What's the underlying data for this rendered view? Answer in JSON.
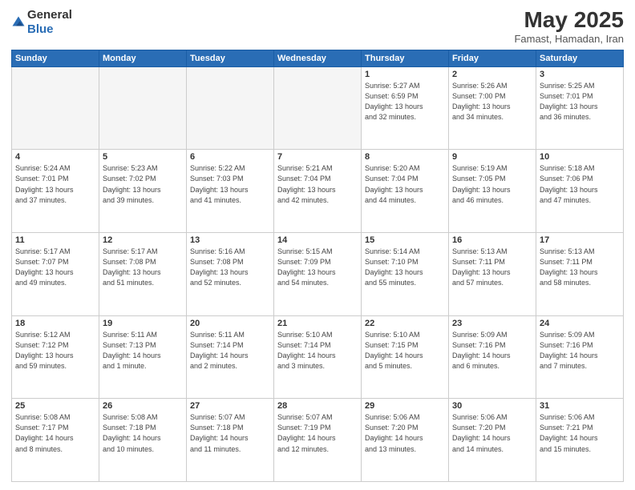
{
  "header": {
    "logo_general": "General",
    "logo_blue": "Blue",
    "month_year": "May 2025",
    "location": "Famast, Hamadan, Iran"
  },
  "weekdays": [
    "Sunday",
    "Monday",
    "Tuesday",
    "Wednesday",
    "Thursday",
    "Friday",
    "Saturday"
  ],
  "weeks": [
    [
      {
        "day": "",
        "info": ""
      },
      {
        "day": "",
        "info": ""
      },
      {
        "day": "",
        "info": ""
      },
      {
        "day": "",
        "info": ""
      },
      {
        "day": "1",
        "info": "Sunrise: 5:27 AM\nSunset: 6:59 PM\nDaylight: 13 hours\nand 32 minutes."
      },
      {
        "day": "2",
        "info": "Sunrise: 5:26 AM\nSunset: 7:00 PM\nDaylight: 13 hours\nand 34 minutes."
      },
      {
        "day": "3",
        "info": "Sunrise: 5:25 AM\nSunset: 7:01 PM\nDaylight: 13 hours\nand 36 minutes."
      }
    ],
    [
      {
        "day": "4",
        "info": "Sunrise: 5:24 AM\nSunset: 7:01 PM\nDaylight: 13 hours\nand 37 minutes."
      },
      {
        "day": "5",
        "info": "Sunrise: 5:23 AM\nSunset: 7:02 PM\nDaylight: 13 hours\nand 39 minutes."
      },
      {
        "day": "6",
        "info": "Sunrise: 5:22 AM\nSunset: 7:03 PM\nDaylight: 13 hours\nand 41 minutes."
      },
      {
        "day": "7",
        "info": "Sunrise: 5:21 AM\nSunset: 7:04 PM\nDaylight: 13 hours\nand 42 minutes."
      },
      {
        "day": "8",
        "info": "Sunrise: 5:20 AM\nSunset: 7:04 PM\nDaylight: 13 hours\nand 44 minutes."
      },
      {
        "day": "9",
        "info": "Sunrise: 5:19 AM\nSunset: 7:05 PM\nDaylight: 13 hours\nand 46 minutes."
      },
      {
        "day": "10",
        "info": "Sunrise: 5:18 AM\nSunset: 7:06 PM\nDaylight: 13 hours\nand 47 minutes."
      }
    ],
    [
      {
        "day": "11",
        "info": "Sunrise: 5:17 AM\nSunset: 7:07 PM\nDaylight: 13 hours\nand 49 minutes."
      },
      {
        "day": "12",
        "info": "Sunrise: 5:17 AM\nSunset: 7:08 PM\nDaylight: 13 hours\nand 51 minutes."
      },
      {
        "day": "13",
        "info": "Sunrise: 5:16 AM\nSunset: 7:08 PM\nDaylight: 13 hours\nand 52 minutes."
      },
      {
        "day": "14",
        "info": "Sunrise: 5:15 AM\nSunset: 7:09 PM\nDaylight: 13 hours\nand 54 minutes."
      },
      {
        "day": "15",
        "info": "Sunrise: 5:14 AM\nSunset: 7:10 PM\nDaylight: 13 hours\nand 55 minutes."
      },
      {
        "day": "16",
        "info": "Sunrise: 5:13 AM\nSunset: 7:11 PM\nDaylight: 13 hours\nand 57 minutes."
      },
      {
        "day": "17",
        "info": "Sunrise: 5:13 AM\nSunset: 7:11 PM\nDaylight: 13 hours\nand 58 minutes."
      }
    ],
    [
      {
        "day": "18",
        "info": "Sunrise: 5:12 AM\nSunset: 7:12 PM\nDaylight: 13 hours\nand 59 minutes."
      },
      {
        "day": "19",
        "info": "Sunrise: 5:11 AM\nSunset: 7:13 PM\nDaylight: 14 hours\nand 1 minute."
      },
      {
        "day": "20",
        "info": "Sunrise: 5:11 AM\nSunset: 7:14 PM\nDaylight: 14 hours\nand 2 minutes."
      },
      {
        "day": "21",
        "info": "Sunrise: 5:10 AM\nSunset: 7:14 PM\nDaylight: 14 hours\nand 3 minutes."
      },
      {
        "day": "22",
        "info": "Sunrise: 5:10 AM\nSunset: 7:15 PM\nDaylight: 14 hours\nand 5 minutes."
      },
      {
        "day": "23",
        "info": "Sunrise: 5:09 AM\nSunset: 7:16 PM\nDaylight: 14 hours\nand 6 minutes."
      },
      {
        "day": "24",
        "info": "Sunrise: 5:09 AM\nSunset: 7:16 PM\nDaylight: 14 hours\nand 7 minutes."
      }
    ],
    [
      {
        "day": "25",
        "info": "Sunrise: 5:08 AM\nSunset: 7:17 PM\nDaylight: 14 hours\nand 8 minutes."
      },
      {
        "day": "26",
        "info": "Sunrise: 5:08 AM\nSunset: 7:18 PM\nDaylight: 14 hours\nand 10 minutes."
      },
      {
        "day": "27",
        "info": "Sunrise: 5:07 AM\nSunset: 7:18 PM\nDaylight: 14 hours\nand 11 minutes."
      },
      {
        "day": "28",
        "info": "Sunrise: 5:07 AM\nSunset: 7:19 PM\nDaylight: 14 hours\nand 12 minutes."
      },
      {
        "day": "29",
        "info": "Sunrise: 5:06 AM\nSunset: 7:20 PM\nDaylight: 14 hours\nand 13 minutes."
      },
      {
        "day": "30",
        "info": "Sunrise: 5:06 AM\nSunset: 7:20 PM\nDaylight: 14 hours\nand 14 minutes."
      },
      {
        "day": "31",
        "info": "Sunrise: 5:06 AM\nSunset: 7:21 PM\nDaylight: 14 hours\nand 15 minutes."
      }
    ]
  ]
}
